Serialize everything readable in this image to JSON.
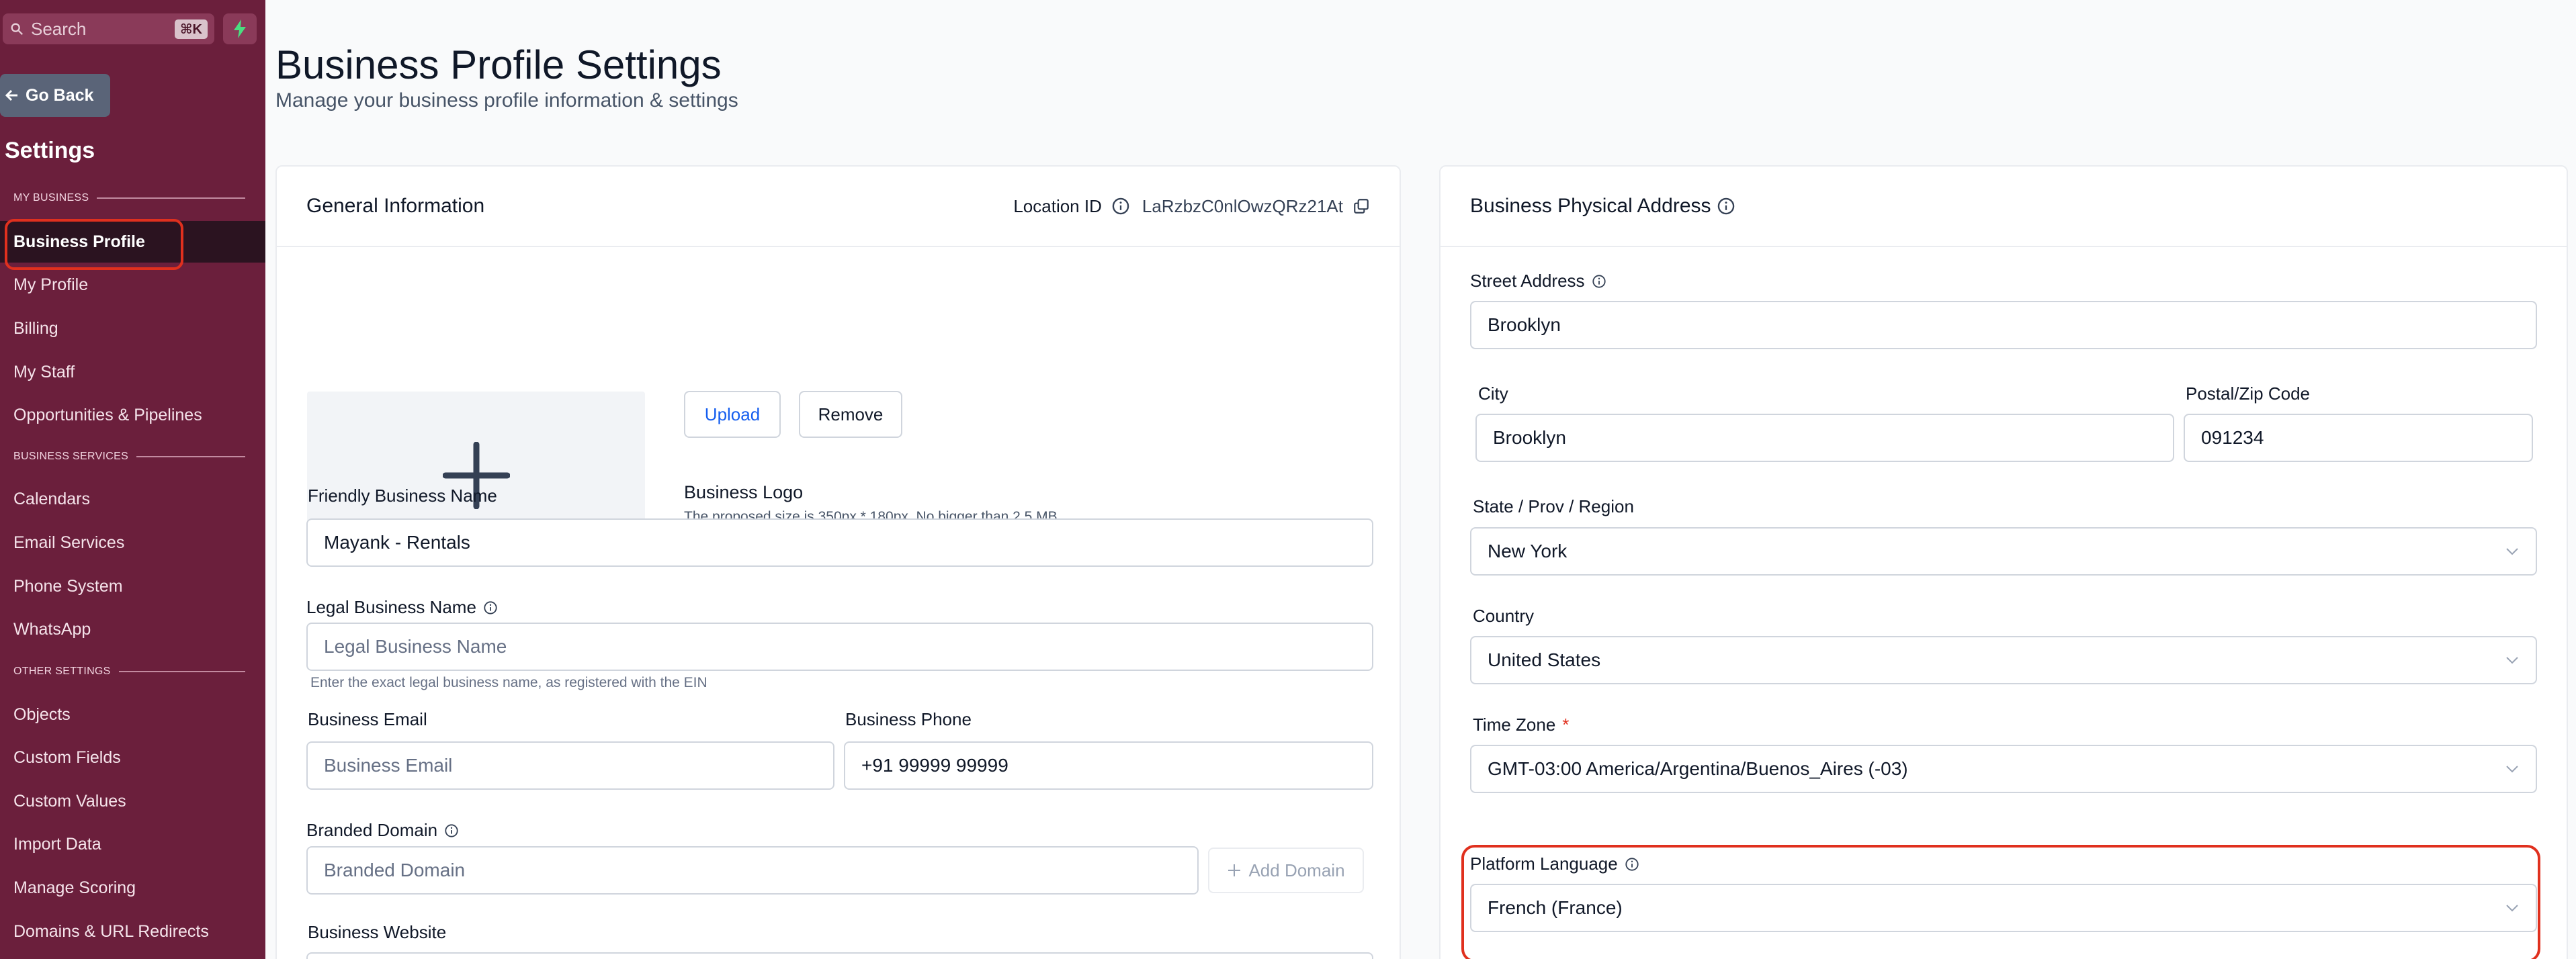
{
  "sidebar": {
    "search_placeholder": "Search",
    "search_shortcut": "⌘K",
    "go_back": "Go Back",
    "title": "Settings",
    "sections": {
      "my_business": "MY BUSINESS",
      "business_services": "BUSINESS SERVICES",
      "other_settings": "OTHER SETTINGS"
    },
    "items": [
      {
        "label": "Business Profile",
        "active": true
      },
      {
        "label": "My Profile"
      },
      {
        "label": "Billing"
      },
      {
        "label": "My Staff"
      },
      {
        "label": "Opportunities & Pipelines"
      },
      {
        "label": "Calendars"
      },
      {
        "label": "Email Services"
      },
      {
        "label": "Phone System"
      },
      {
        "label": "WhatsApp"
      },
      {
        "label": "Objects"
      },
      {
        "label": "Custom Fields"
      },
      {
        "label": "Custom Values"
      },
      {
        "label": "Import Data"
      },
      {
        "label": "Manage Scoring"
      },
      {
        "label": "Domains & URL Redirects"
      }
    ]
  },
  "header": {
    "title": "Business Profile Settings",
    "subtitle": "Manage your business profile information & settings"
  },
  "general": {
    "title": "General Information",
    "location_id_label": "Location ID",
    "location_id_value": "LaRzbzC0nlOwzQRz21At",
    "logo_title": "Business Logo",
    "logo_hint": "The proposed size is 350px * 180px. No bigger than 2.5 MB",
    "upload_label": "Upload",
    "remove_label": "Remove",
    "friendly_name_label": "Friendly Business Name",
    "friendly_name_value": "Mayank - Rentals",
    "legal_name_label": "Legal Business Name",
    "legal_name_placeholder": "Legal Business Name",
    "legal_name_hint": "Enter the exact legal business name, as registered with the EIN",
    "email_label": "Business Email",
    "email_placeholder": "Business Email",
    "phone_label": "Business Phone",
    "phone_value": "+91 99999 99999",
    "domain_label": "Branded Domain",
    "domain_placeholder": "Branded Domain",
    "add_domain_label": "Add Domain",
    "website_label": "Business Website"
  },
  "address": {
    "title": "Business Physical Address",
    "street_label": "Street Address",
    "street_value": "Brooklyn",
    "city_label": "City",
    "city_value": "Brooklyn",
    "zip_label": "Postal/Zip Code",
    "zip_value": "091234",
    "state_label": "State / Prov / Region",
    "state_value": "New York",
    "country_label": "Country",
    "country_value": "United States",
    "timezone_label": "Time Zone",
    "timezone_required": "*",
    "timezone_value": "GMT-03:00 America/Argentina/Buenos_Aires (-03)",
    "language_label": "Platform Language",
    "language_value": "French (France)"
  },
  "colors": {
    "sidebar_bg": "#6b1f3c",
    "active_item_bg": "#2b1320",
    "highlight": "#e0301e",
    "link_blue": "#155eef"
  }
}
